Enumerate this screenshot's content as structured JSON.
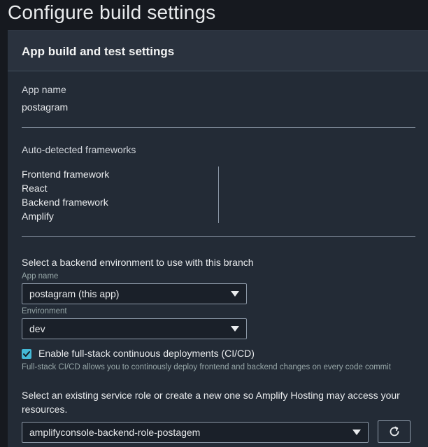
{
  "page": {
    "title": "Configure build settings"
  },
  "panel": {
    "title": "App build and test settings",
    "app_name_label": "App name",
    "app_name_value": "postagram",
    "frameworks_heading": "Auto-detected frameworks",
    "frontend_label": "Frontend framework",
    "frontend_value": "React",
    "backend_label": "Backend framework",
    "backend_value": "Amplify",
    "backend_env_heading": "Select a backend environment to use with this branch",
    "app_select_label": "App name",
    "app_select_value": "postagram (this app)",
    "env_select_label": "Environment",
    "env_select_value": "dev",
    "cicd_checkbox_label": "Enable full-stack continuous deployments (CI/CD)",
    "cicd_checked": true,
    "cicd_hint": "Full-stack CI/CD allows you to continously deploy frontend and backend changes on every code commit",
    "service_role_text": "Select an existing service role or create a new one so Amplify Hosting may access your resources.",
    "service_role_value": "amplifyconsole-backend-role-postagem"
  },
  "icons": {
    "select_caret": "caret-down-icon",
    "checkbox_check": "check-icon",
    "refresh": "refresh-icon"
  },
  "colors": {
    "page_bg": "#16191f",
    "panel_bg": "#232b36",
    "accent": "#44b9d6"
  }
}
